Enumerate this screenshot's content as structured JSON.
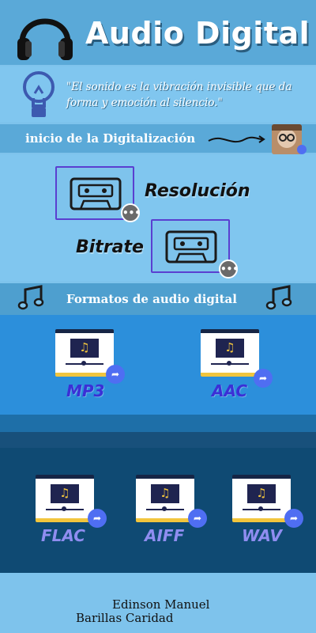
{
  "header": {
    "title": "Audio Digital",
    "icon": "headphones-icon"
  },
  "quote": {
    "text": "\"El sonido es la vibración invisible que da forma y emoción al silencio.\"",
    "icon": "lightbulb-icon"
  },
  "digitalization": {
    "label": "inicio de la Digitalización",
    "avatar_icon": "avatar-icon"
  },
  "concepts": [
    {
      "label": "Resolución",
      "icon": "cassette-icon"
    },
    {
      "label": "Bitrate",
      "icon": "cassette-icon"
    }
  ],
  "formats": {
    "label": "Formatos de audio digital",
    "icon": "music-note-icon",
    "items": [
      {
        "label": "MP3"
      },
      {
        "label": "AAC"
      },
      {
        "label": "FLAC"
      },
      {
        "label": "AIFF"
      },
      {
        "label": "WAV"
      }
    ]
  },
  "author": {
    "line1": "Edinson Manuel",
    "line2": "Barillas Caridad"
  },
  "colors": {
    "header": "#5aa9d8",
    "accent_purple": "#5a3fd0",
    "share": "#4f6ef2",
    "dark": "#0f4a73"
  }
}
